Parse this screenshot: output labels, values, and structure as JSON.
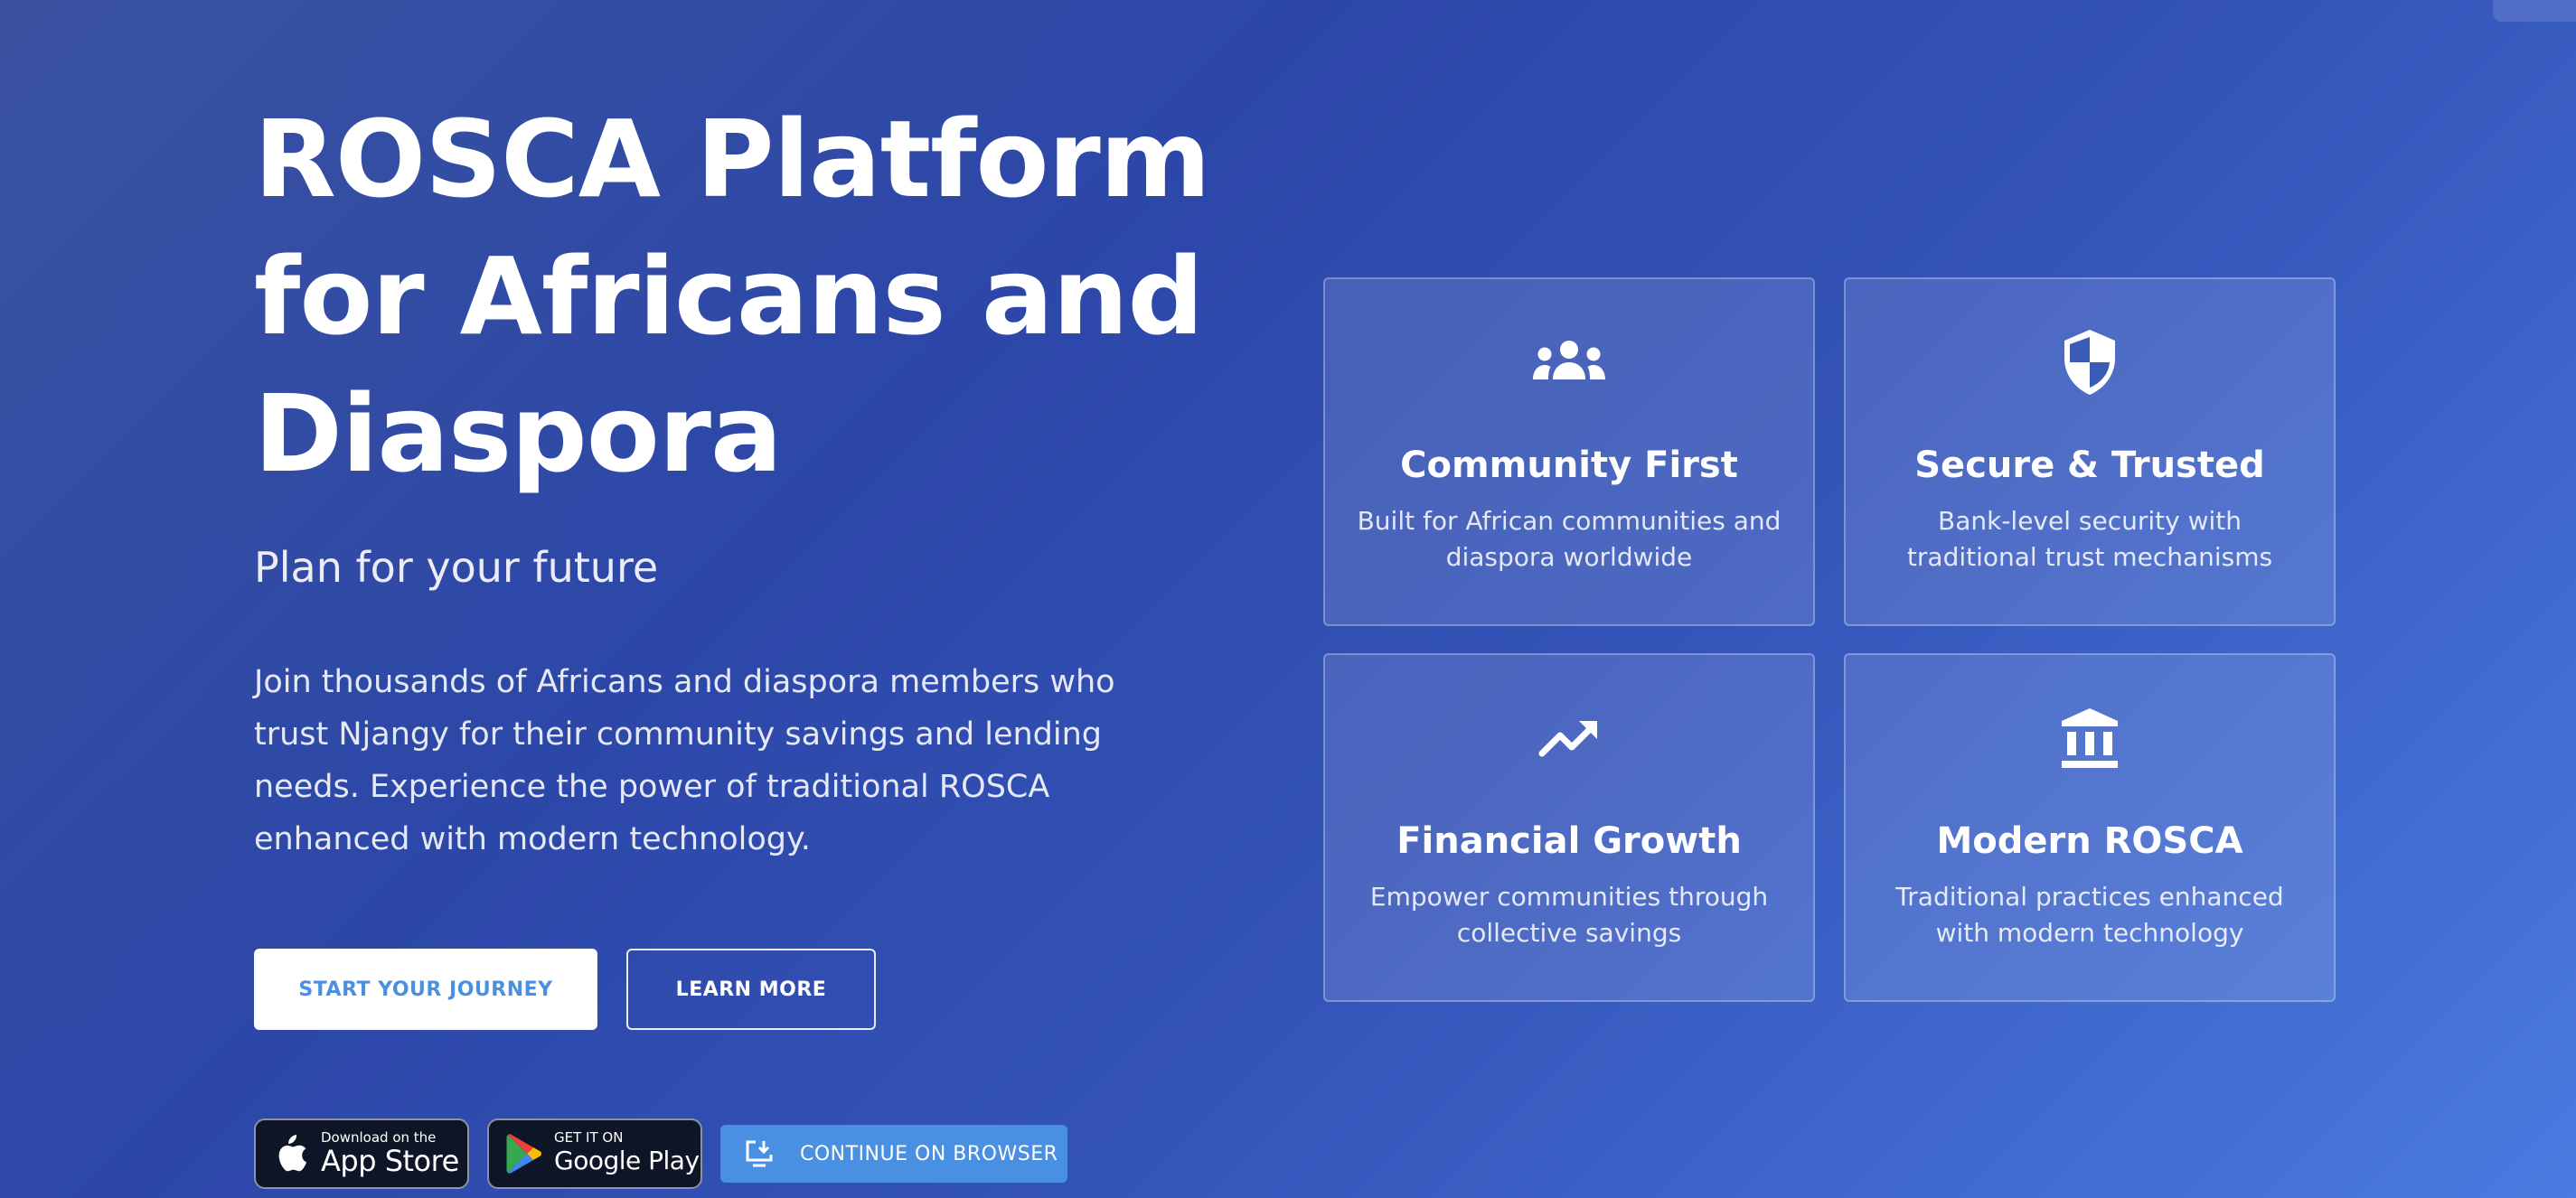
{
  "hero": {
    "title_line1": "ROSCA Platform",
    "title_line2": "for Africans and",
    "title_line3": "Diaspora",
    "subtitle": "Plan for your future",
    "body": "Join thousands of Africans and diaspora members who trust Njangy for their community savings and lending needs. Experience the power of traditional ROSCA enhanced with modern technology."
  },
  "cta": {
    "primary_label": "START YOUR JOURNEY",
    "secondary_label": "LEARN MORE"
  },
  "stores": {
    "apple_small": "Download on the",
    "apple_big": "App Store",
    "google_small": "GET IT ON",
    "google_big": "Google Play",
    "browser_label": "CONTINUE ON BROWSER"
  },
  "features": [
    {
      "icon": "groups-icon",
      "title": "Community First",
      "description": "Built for African communities and diaspora worldwide"
    },
    {
      "icon": "shield-icon",
      "title": "Secure & Trusted",
      "description": "Bank-level security with traditional trust mechanisms"
    },
    {
      "icon": "trending-up-icon",
      "title": "Financial Growth",
      "description": "Empower communities through collective savings"
    },
    {
      "icon": "bank-icon",
      "title": "Modern ROSCA",
      "description": "Traditional practices enhanced with modern technology"
    }
  ],
  "colors": {
    "gradient_start": "#3a52a0",
    "gradient_end": "#4a7be0",
    "accent": "#4a90e2",
    "badge_bg": "#0e1526"
  }
}
